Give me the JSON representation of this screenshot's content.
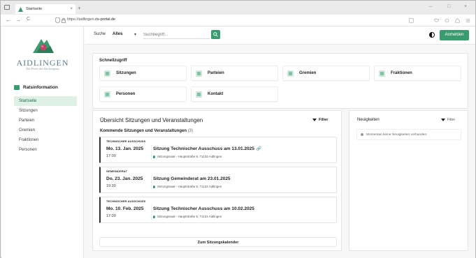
{
  "browser": {
    "tab_title": "Startseite",
    "tab_close": "×",
    "new_tab": "+",
    "url_prefix": "https://aidlingen.",
    "url_domain": "ris-portal.de",
    "back": "←",
    "forward": "→",
    "reload": "C",
    "min": "–",
    "max": "□",
    "close": "×"
  },
  "sidebar": {
    "logo_text": "AIDLINGEN",
    "logo_sub": "Die Perle des Heckengäus",
    "section_title": "Ratsinformation",
    "items": [
      {
        "label": "Startseite",
        "active": true
      },
      {
        "label": "Sitzungen",
        "active": false
      },
      {
        "label": "Parteien",
        "active": false
      },
      {
        "label": "Gremien",
        "active": false
      },
      {
        "label": "Fraktionen",
        "active": false
      },
      {
        "label": "Personen",
        "active": false
      }
    ]
  },
  "search": {
    "label": "Suche",
    "scope": "Alles",
    "chevron": "▾",
    "placeholder": "Suchbegriff...",
    "button_icon": "⚲"
  },
  "header": {
    "login_label": "Anmelden"
  },
  "quick_access": {
    "title": "Schnellzugriff",
    "tiles": [
      "Sitzungen",
      "Parteien",
      "Gremien",
      "Fraktionen",
      "Personen",
      "Kontakt"
    ]
  },
  "overview": {
    "title": "Übersicht Sitzungen und Veranstaltungen",
    "filter_label": "Filter",
    "subtitle": "Kommende Sitzungen und Veranstaltungen",
    "count": "(3)",
    "events": [
      {
        "category": "TECHNISCHER AUSSCHUSS",
        "date": "Mo. 13. Jan. 2025",
        "time": "17:00",
        "title": "Sitzung Technischer Ausschuss am 13.01.2025",
        "attachment": "🔗",
        "location": "Sitzungssaal - Hauptstraße 6, 71134 Aidlingen"
      },
      {
        "category": "GEMEINDERAT",
        "date": "Do. 23. Jan. 2025",
        "time": "19:30",
        "title": "Sitzung Gemeinderat am 23.01.2025",
        "attachment": "",
        "location": "Sitzungssaal - Hauptstraße 6, 71134 Aidlingen"
      },
      {
        "category": "TECHNISCHER AUSSCHUSS",
        "date": "Mo. 10. Feb. 2025",
        "time": "17:00",
        "title": "Sitzung Technischer Ausschuss am 10.02.2025",
        "attachment": "",
        "location": "Sitzungssaal - Hauptstraße 6, 71134 Aidlingen"
      }
    ],
    "calendar_button": "Zum Sitzungskalender"
  },
  "news": {
    "title": "Neuigkeiten",
    "filter_label": "Filter",
    "empty_text": "Momentan keine Neuigkeiten vorhanden."
  },
  "colors": {
    "accent": "#3a9c6e",
    "active_bg": "#dff0e7"
  }
}
